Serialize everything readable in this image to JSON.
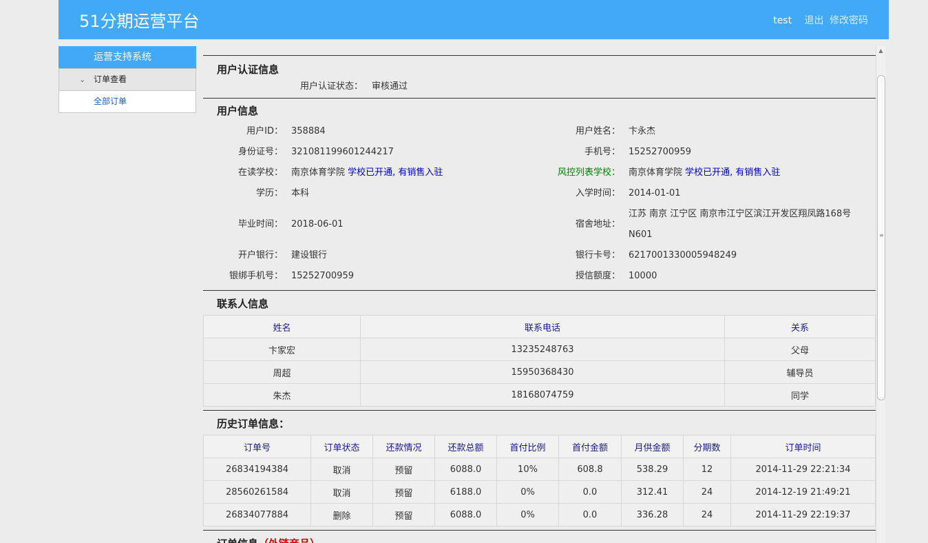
{
  "header": {
    "title": "51分期运营平台",
    "user": "test",
    "logout": "退出",
    "change_password": "修改密码"
  },
  "sidebar": {
    "head": "运营支持系统",
    "group": "订单查看",
    "item": "全部订单"
  },
  "auth": {
    "title": "用户认证信息",
    "status_label": "用户认证状态：",
    "status_value": "审核通过"
  },
  "userinfo": {
    "title": "用户信息",
    "user_id_label": "用户ID：",
    "user_id": "358884",
    "name_label": "用户姓名：",
    "name": "卞永杰",
    "idcard_label": "身份证号：",
    "idcard": "321081199601244217",
    "phone_label": "手机号：",
    "phone": "15252700959",
    "school_label": "在读学校：",
    "school": "南京体育学院",
    "school_note": "学校已开通, 有销售入驻",
    "risk_label": "风控列表学校：",
    "risk_school": "南京体育学院",
    "risk_note": "学校已开通, 有销售入驻",
    "edu_label": "学历：",
    "edu": "本科",
    "enroll_label": "入学时间：",
    "enroll": "2014-01-01",
    "grad_label": "毕业时间：",
    "grad": "2018-06-01",
    "dorm_label": "宿舍地址：",
    "dorm_line1": "江苏 南京 江宁区 南京市江宁区滨江开发区翔凤路168号",
    "dorm_line2": "N601",
    "bank_label": "开户银行：",
    "bank": "建设银行",
    "card_label": "银行卡号：",
    "card": "6217001330005948249",
    "bindphone_label": "银绑手机号：",
    "bindphone": "15252700959",
    "credit_label": "授信额度：",
    "credit": "10000"
  },
  "contacts": {
    "title": "联系人信息",
    "headers": [
      "姓名",
      "联系电话",
      "关系"
    ],
    "rows": [
      [
        "卞家宏",
        "13235248763",
        "父母"
      ],
      [
        "周超",
        "15950368430",
        "辅导员"
      ],
      [
        "朱杰",
        "18168074759",
        "同学"
      ]
    ]
  },
  "history": {
    "title": "历史订单信息：",
    "headers": [
      "订单号",
      "订单状态",
      "还款情况",
      "还款总额",
      "首付比例",
      "首付金额",
      "月供金额",
      "分期数",
      "订单时间"
    ],
    "rows": [
      [
        "26834194384",
        "取消",
        "预留",
        "6088.0",
        "10%",
        "608.8",
        "538.29",
        "12",
        "2014-11-29 22:21:34"
      ],
      [
        "28560261584",
        "取消",
        "预留",
        "6188.0",
        "0%",
        "0.0",
        "312.41",
        "24",
        "2014-12-19 21:49:21"
      ],
      [
        "26834077884",
        "删除",
        "预留",
        "6088.0",
        "0%",
        "0.0",
        "336.28",
        "24",
        "2014-11-29 22:19:37"
      ]
    ]
  },
  "orderinfo": {
    "title": "订单信息",
    "tag": "（外链商品）"
  },
  "colors": {
    "header": "#42a9f8",
    "link": "#0000cc",
    "risk": "#008000",
    "red": "#d40000"
  }
}
